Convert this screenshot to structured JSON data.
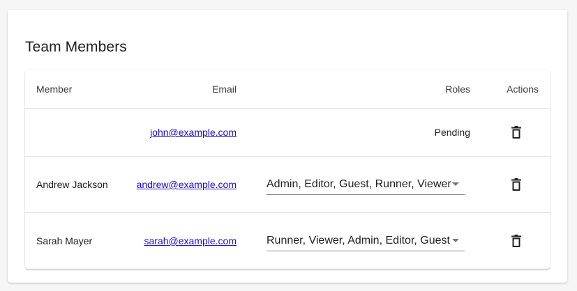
{
  "card": {
    "title": "Team Members"
  },
  "table": {
    "headers": {
      "member": "Member",
      "email": "Email",
      "roles": "Roles",
      "actions": "Actions"
    },
    "rows": [
      {
        "member": "",
        "email": "john@example.com",
        "roles": "Pending",
        "delete_icon": "trash-icon"
      },
      {
        "member": "Andrew Jackson",
        "email": "andrew@example.com",
        "roles": "Admin, Editor, Guest, Runner, Viewer",
        "delete_icon": "trash-icon"
      },
      {
        "member": "Sarah Mayer",
        "email": "sarah@example.com",
        "roles": "Runner, Viewer, Admin, Editor, Guest",
        "delete_icon": "trash-icon"
      }
    ]
  },
  "colors": {
    "link": "#1a0dcc",
    "background": "#f6f6f6",
    "card": "#ffffff"
  }
}
